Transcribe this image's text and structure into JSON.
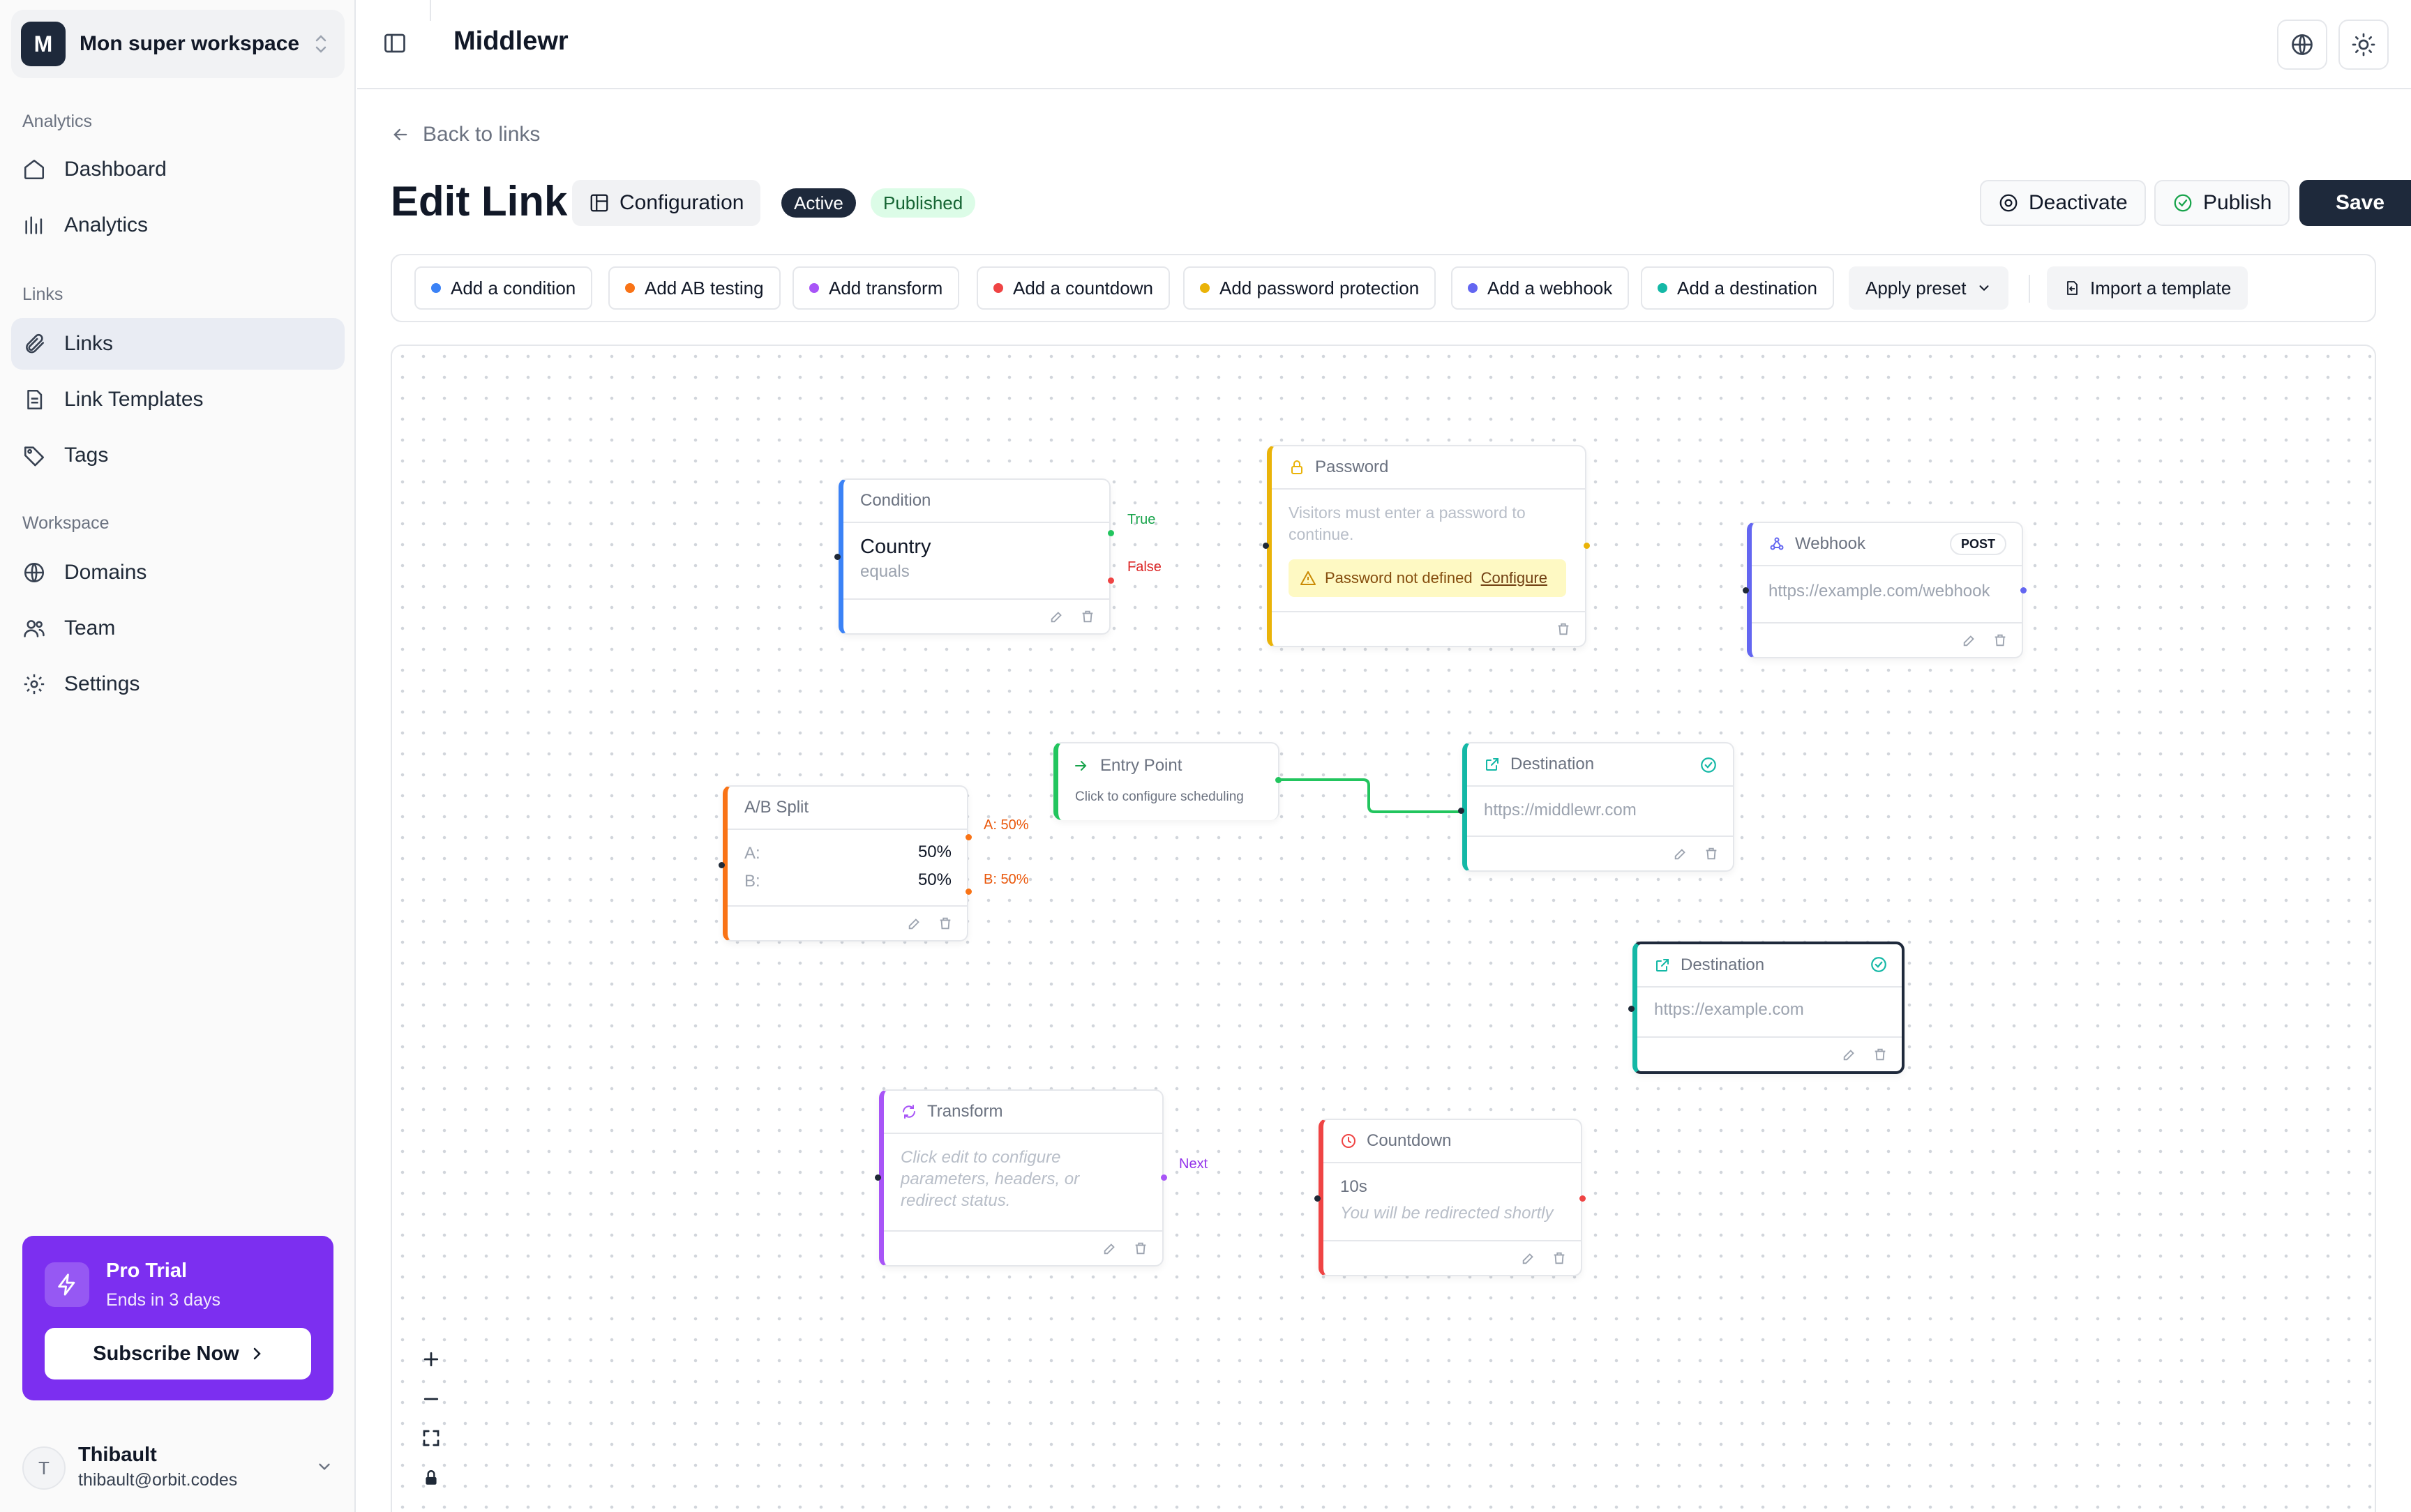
{
  "workspace": {
    "initial": "M",
    "name": "Mon super workspace"
  },
  "sidebar": {
    "sections": {
      "analytics": "Analytics",
      "links": "Links",
      "workspace": "Workspace"
    },
    "items": {
      "dashboard": "Dashboard",
      "analytics": "Analytics",
      "links": "Links",
      "link_templates": "Link Templates",
      "tags": "Tags",
      "domains": "Domains",
      "team": "Team",
      "settings": "Settings"
    },
    "active_item": "Links",
    "trial": {
      "title": "Pro Trial",
      "subtitle": "Ends in 3 days",
      "button": "Subscribe Now"
    },
    "user": {
      "initial": "T",
      "name": "Thibault",
      "email": "thibault@orbit.codes"
    }
  },
  "topbar": {
    "title": "Middlewr"
  },
  "header": {
    "back": "Back to links",
    "title": "Edit Link",
    "configuration": "Configuration",
    "badge_active": "Active",
    "badge_published": "Published",
    "deactivate": "Deactivate",
    "publish": "Publish",
    "save": "Save"
  },
  "toolbar": {
    "add_condition": "Add a condition",
    "add_ab": "Add AB testing",
    "add_transform": "Add transform",
    "add_countdown": "Add a countdown",
    "add_password": "Add password protection",
    "add_webhook": "Add a webhook",
    "add_destination": "Add a destination",
    "apply_preset": "Apply preset",
    "import_template": "Import a template"
  },
  "colors": {
    "condition": "#3b82f6",
    "ab": "#f97316",
    "transform": "#a855f7",
    "countdown": "#ef4444",
    "password": "#eab308",
    "webhook": "#6366f1",
    "destination": "#14b8a6",
    "entry": "#22c55e",
    "trial": "#7c2ff0"
  },
  "nodes": {
    "condition": {
      "header": "Condition",
      "field": "Country",
      "operator": "equals",
      "true_label": "True",
      "false_label": "False"
    },
    "password": {
      "header": "Password",
      "description": "Visitors must enter a password to continue.",
      "warning": "Password not defined",
      "configure": "Configure"
    },
    "webhook": {
      "header": "Webhook",
      "method": "POST",
      "url": "https://example.com/webhook"
    },
    "ab": {
      "header": "A/B Split",
      "a_label": "A:",
      "a_value": "50%",
      "b_label": "B:",
      "b_value": "50%",
      "out_a": "A: 50%",
      "out_b": "B: 50%"
    },
    "entry": {
      "header": "Entry Point",
      "subtitle": "Click to configure scheduling"
    },
    "destination1": {
      "header": "Destination",
      "url": "https://middlewr.com"
    },
    "destination2": {
      "header": "Destination",
      "url": "https://example.com"
    },
    "transform": {
      "header": "Transform",
      "description": "Click edit to configure parameters, headers, or redirect status.",
      "next_label": "Next"
    },
    "countdown": {
      "header": "Countdown",
      "seconds": "10s",
      "message": "You will be redirected shortly"
    }
  }
}
